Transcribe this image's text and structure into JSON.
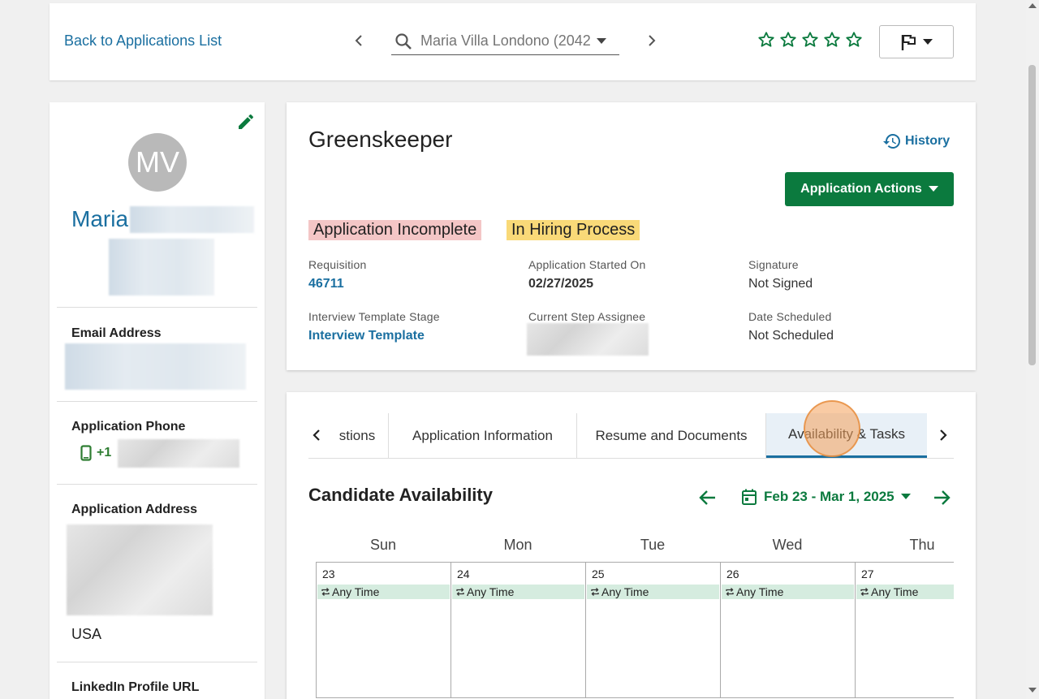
{
  "topbar": {
    "back_label": "Back to Applications List",
    "search_placeholder": "Maria Villa Londono (2042",
    "rating": 0,
    "rating_max": 5
  },
  "profile": {
    "initials": "MV",
    "first_name": "Maria",
    "email_label": "Email Address",
    "phone_label": "Application Phone",
    "phone_prefix": "+1",
    "address_label": "Application Address",
    "country": "USA",
    "linkedin_label": "LinkedIn Profile URL"
  },
  "detail": {
    "title": "Greenskeeper",
    "history_label": "History",
    "actions_label": "Application Actions",
    "badges": [
      "Application Incomplete",
      "In Hiring Process"
    ],
    "requisition_label": "Requisition",
    "requisition_value": "46711",
    "started_label": "Application Started On",
    "started_value": "02/27/2025",
    "signature_label": "Signature",
    "signature_value": "Not Signed",
    "template_label": "Interview Template Stage",
    "template_value": "Interview Template",
    "assignee_label": "Current Step Assignee",
    "scheduled_label": "Date Scheduled",
    "scheduled_value": "Not Scheduled"
  },
  "tabs": [
    {
      "label": "stions"
    },
    {
      "label": "Application Information"
    },
    {
      "label": "Resume and Documents"
    },
    {
      "label": "Availability & Tasks",
      "active": true
    }
  ],
  "availability": {
    "title": "Candidate Availability",
    "range": "Feb 23 - Mar 1, 2025",
    "day_names": [
      "Sun",
      "Mon",
      "Tue",
      "Wed",
      "Thu"
    ],
    "days": [
      {
        "num": "23",
        "slot": "Any Time"
      },
      {
        "num": "24",
        "slot": "Any Time"
      },
      {
        "num": "25",
        "slot": "Any Time"
      },
      {
        "num": "26",
        "slot": "Any Time"
      },
      {
        "num": "27",
        "slot": "Any Time"
      }
    ]
  },
  "colors": {
    "accent_blue": "#1a6fa0",
    "accent_green": "#0b7a3e",
    "badge_red": "#f4c6c6",
    "badge_yellow": "#f9d978"
  }
}
